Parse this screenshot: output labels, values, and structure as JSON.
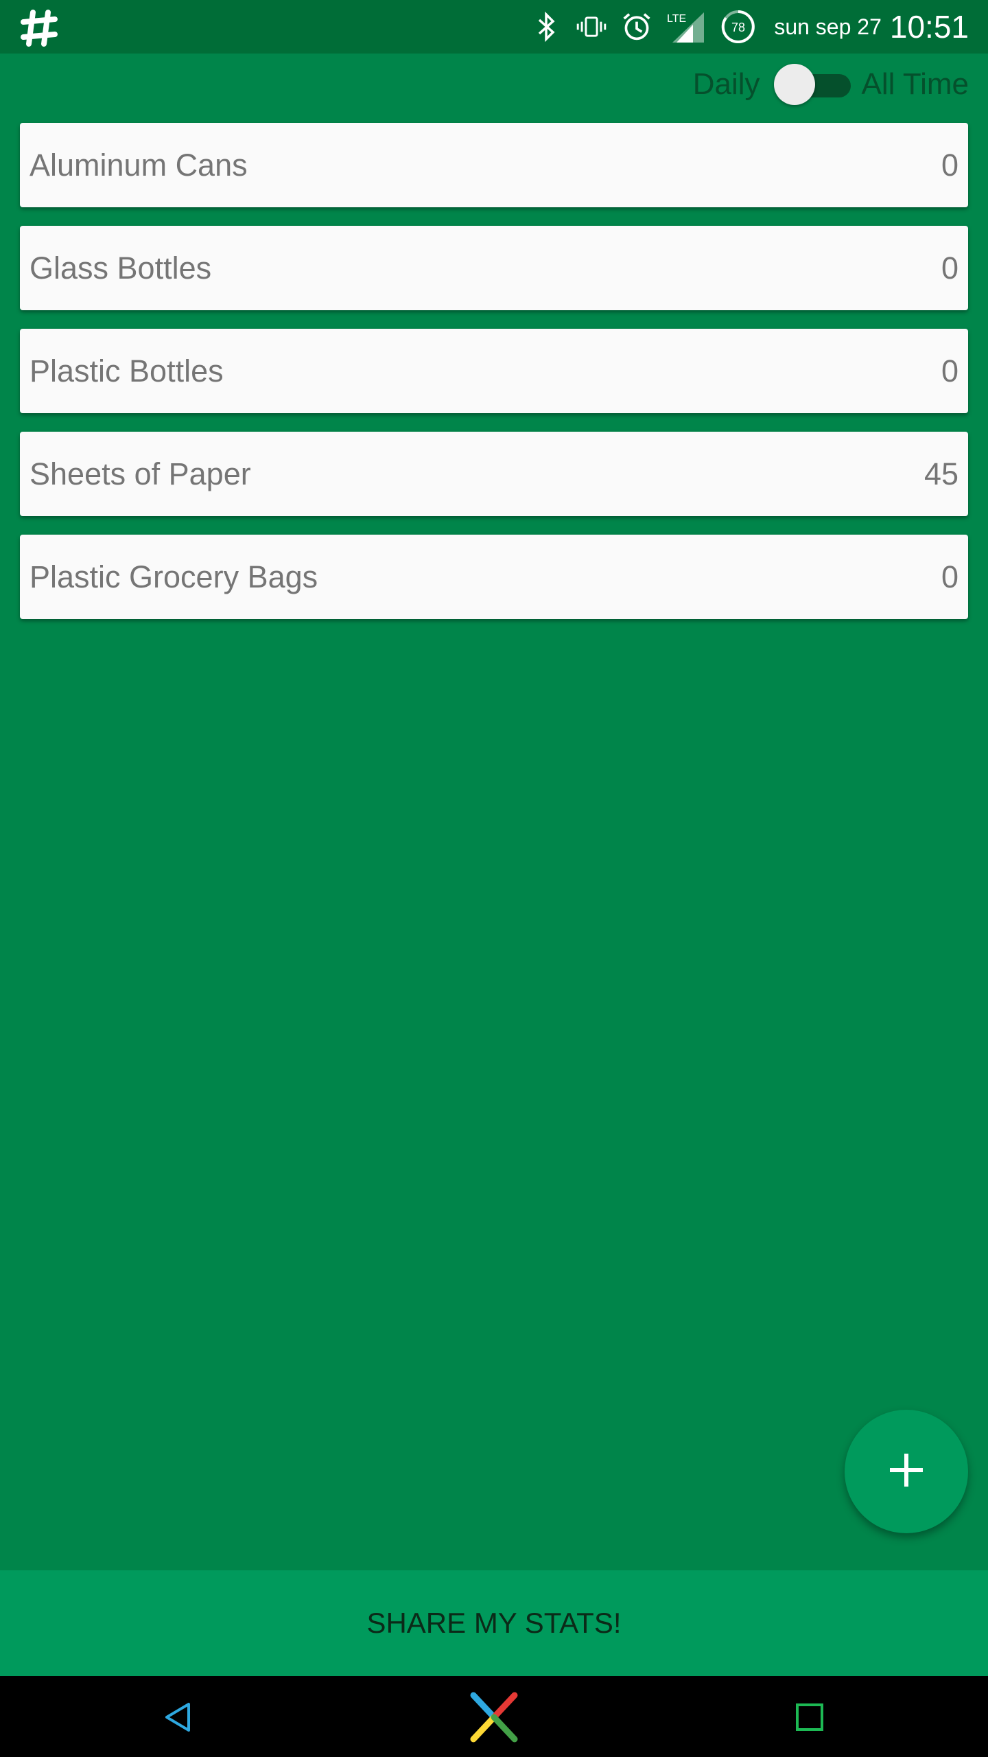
{
  "status_bar": {
    "app_icon": "slack-hash-icon",
    "icons": [
      "bluetooth-icon",
      "vibrate-icon",
      "alarm-icon",
      "lte-signal-icon",
      "battery-icon"
    ],
    "network_label": "LTE",
    "battery_level": "78",
    "date": "sun sep 27",
    "time": "10:51"
  },
  "toggle": {
    "left_label": "Daily",
    "right_label": "All Time",
    "state": "Daily"
  },
  "items": [
    {
      "name": "Aluminum Cans",
      "count": "0"
    },
    {
      "name": "Glass Bottles",
      "count": "0"
    },
    {
      "name": "Plastic Bottles",
      "count": "0"
    },
    {
      "name": "Sheets of Paper",
      "count": "45"
    },
    {
      "name": "Plastic Grocery Bags",
      "count": "0"
    }
  ],
  "fab": {
    "icon": "plus-icon"
  },
  "share_button": {
    "label": "SHARE MY STATS!"
  },
  "nav_bar": {
    "icons": [
      "back-icon",
      "home-icon",
      "recents-icon"
    ]
  },
  "colors": {
    "background": "#00854a",
    "status_bar": "#006d37",
    "accent": "#009a5c",
    "card": "#fafafa",
    "card_text": "#757575"
  }
}
